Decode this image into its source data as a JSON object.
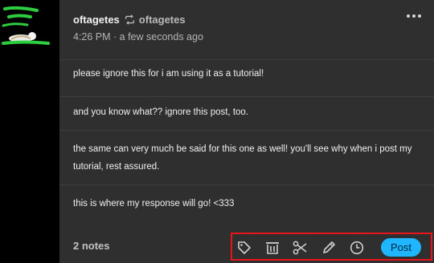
{
  "post": {
    "author": "oftagetes",
    "reblogged_from": "oftagetes",
    "timestamp": "4:26 PM · a few seconds ago",
    "entries": [
      "please ignore this for i am using it as a tutorial!",
      "and you know what?? ignore this post, too.",
      "the same can very much be said for this one as well! you'll see why when i post my tutorial, rest assured.",
      "this is where my response will go! <333"
    ],
    "notes": "2 notes"
  },
  "toolbar": {
    "icons": [
      "tag-icon",
      "trash-icon",
      "scissors-icon",
      "pencil-icon",
      "clock-icon"
    ],
    "post_label": "Post"
  },
  "colors": {
    "card_bg": "#2f2f2f",
    "page_bg": "#000000",
    "accent": "#1fb5ff",
    "highlight_border": "#e8141c",
    "avatar_green": "#2ecc40"
  }
}
